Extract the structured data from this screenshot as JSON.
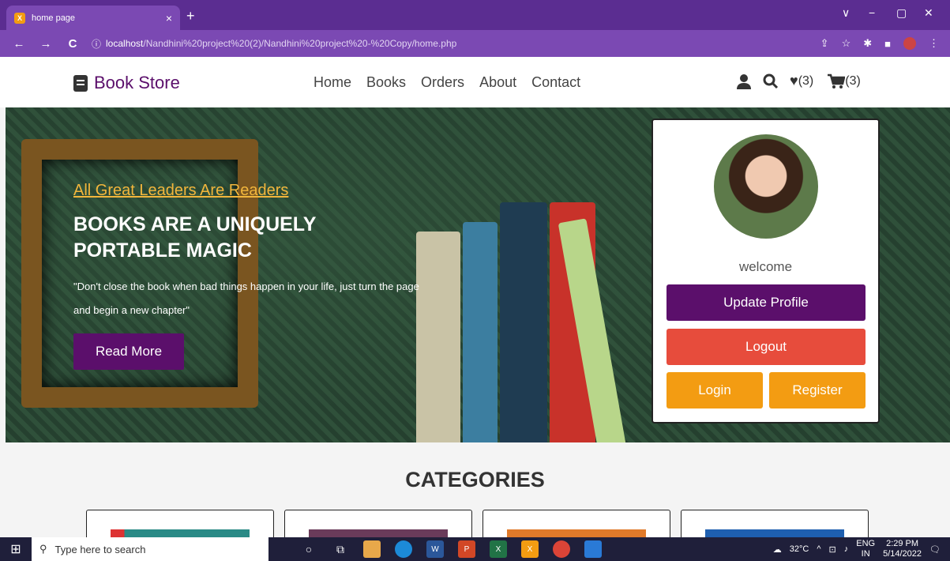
{
  "browser": {
    "tab_title": "home page",
    "tab_close": "×",
    "new_tab": "+",
    "url_host": "localhost",
    "url_path": "/Nandhini%20project%20(2)/Nandhini%20project%20-%20Copy/home.php",
    "back": "←",
    "forward": "→",
    "reload": "C",
    "info": "ⓘ",
    "window_controls": [
      "∨",
      "−",
      "▢",
      "✕"
    ]
  },
  "header": {
    "logo": "Book Store",
    "nav": [
      "Home",
      "Books",
      "Orders",
      "About",
      "Contact"
    ],
    "wishlist_count": "(3)",
    "cart_count": "(3)"
  },
  "hero": {
    "subtitle": "All Great Leaders Are Readers",
    "title": "BOOKS ARE A UNIQUELY PORTABLE MAGIC",
    "quote": "\"Don't close the book when bad things happen in your life, just turn the page and begin a new chapter\"",
    "button": "Read More"
  },
  "profile_card": {
    "welcome": "welcome",
    "update": "Update Profile",
    "logout": "Logout",
    "login": "Login",
    "register": "Register"
  },
  "categories": {
    "title": "CATEGORIES"
  },
  "taskbar": {
    "search_placeholder": "Type here to search",
    "weather": "32°C",
    "lang1": "ENG",
    "lang2": "IN",
    "time": "2:29 PM",
    "date": "5/14/2022"
  }
}
